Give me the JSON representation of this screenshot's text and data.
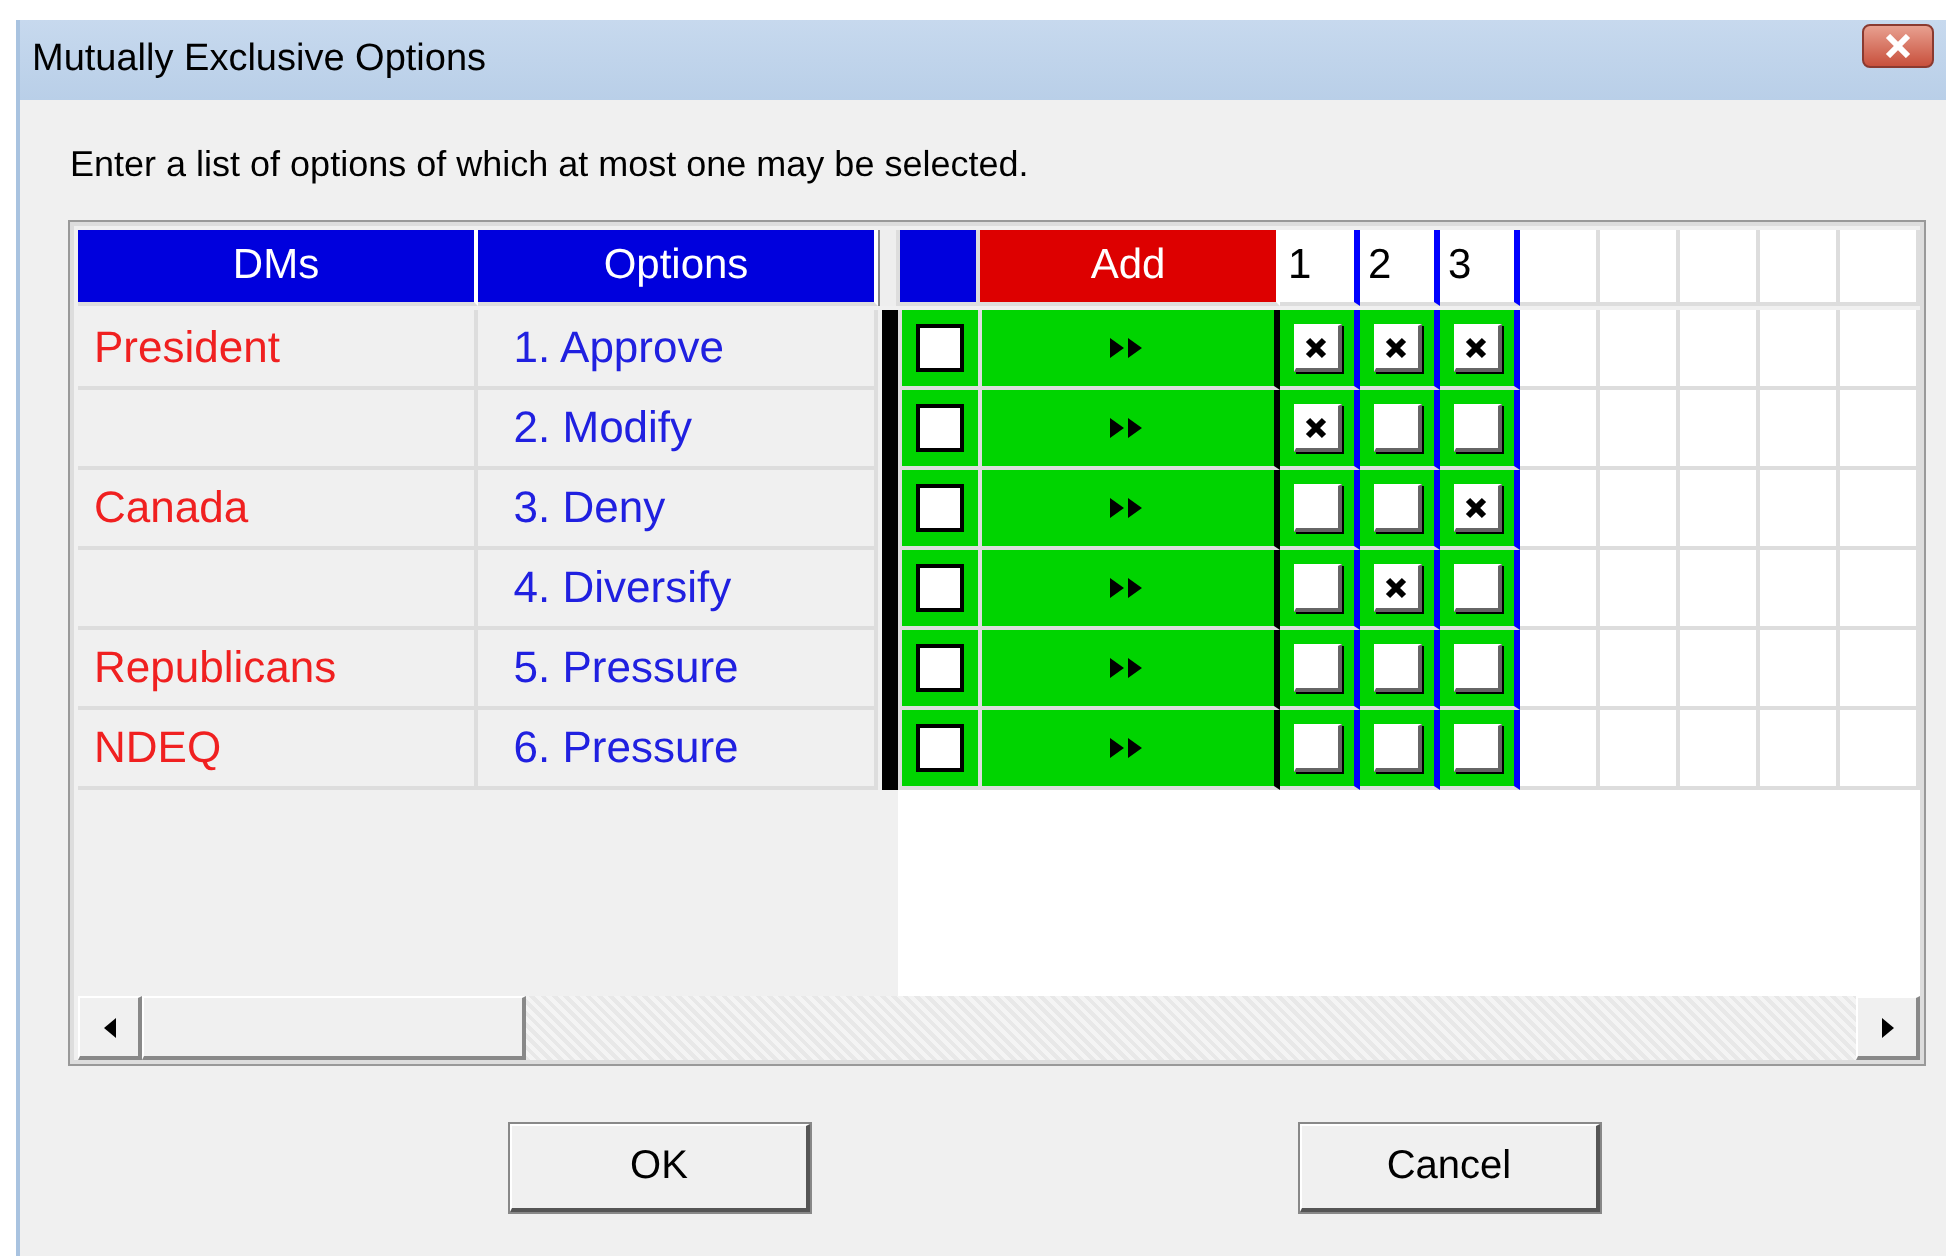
{
  "window": {
    "title": "Mutually Exclusive Options"
  },
  "instruction": "Enter a list of options of which at most one may be selected.",
  "table": {
    "columns": [
      {
        "label": "DMs"
      },
      {
        "label": "Options"
      },
      {
        "label": "Add"
      }
    ],
    "mark_columns": [
      "1",
      "2",
      "3"
    ],
    "rows": [
      {
        "dm": "President",
        "option": "1. Approve",
        "checked": false,
        "marks": [
          true,
          true,
          true
        ]
      },
      {
        "option": "2. Modify",
        "checked": false,
        "marks": [
          true,
          false,
          false
        ]
      },
      {
        "dm": "Canada",
        "option": "3. Deny",
        "checked": false,
        "marks": [
          false,
          false,
          true
        ]
      },
      {
        "option": "4. Diversify",
        "checked": false,
        "marks": [
          false,
          true,
          false
        ]
      },
      {
        "dm": "Republicans",
        "option": "5. Pressure",
        "checked": false,
        "marks": [
          false,
          false,
          false
        ]
      },
      {
        "dm": "NDEQ",
        "option": "6. Pressure",
        "checked": false,
        "marks": [
          false,
          false,
          false
        ]
      }
    ]
  },
  "buttons": [
    {
      "label": "OK"
    },
    {
      "label": "Cancel"
    }
  ]
}
